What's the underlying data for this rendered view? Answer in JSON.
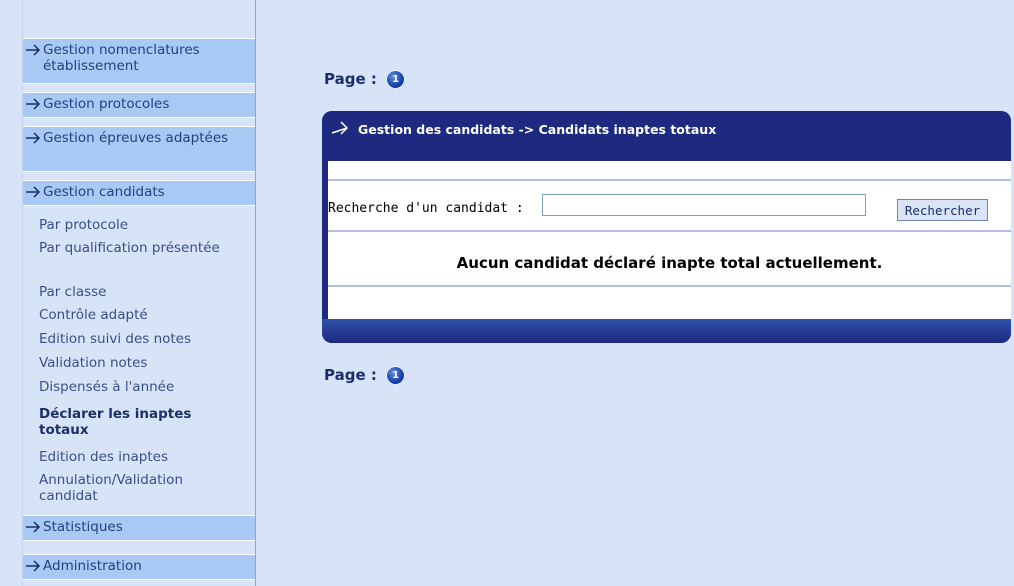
{
  "sidebar": {
    "sections": [
      {
        "label": "Gestion nomenclatures établissement"
      },
      {
        "label": "Gestion protocoles"
      },
      {
        "label": "Gestion épreuves adaptées"
      },
      {
        "label": "Gestion candidats"
      },
      {
        "label": "Statistiques"
      },
      {
        "label": "Administration"
      }
    ],
    "sub_items": [
      {
        "label": "Par protocole"
      },
      {
        "label": "Par qualification présentée"
      },
      {
        "label": "Par classe"
      },
      {
        "label": "Contrôle adapté"
      },
      {
        "label": "Edition suivi des notes"
      },
      {
        "label": "Validation notes"
      },
      {
        "label": "Dispensés à l'année"
      },
      {
        "label": "Déclarer les inaptes totaux"
      },
      {
        "label": "Edition des inaptes"
      },
      {
        "label": "Annulation/Validation candidat"
      }
    ]
  },
  "pagination": {
    "label": "Page :",
    "current": "1"
  },
  "panel": {
    "title": "Gestion des candidats -> Candidats inaptes totaux",
    "search_label": "Recherche d'un candidat :",
    "search_value": "",
    "search_button": "Rechercher",
    "empty_message": "Aucun candidat déclaré inapte total actuellement."
  },
  "colors": {
    "background": "#d7e3f7",
    "sidebar_header": "#a9c9f5",
    "panel": "#1d2a80",
    "accent": "#1c2d6e"
  }
}
